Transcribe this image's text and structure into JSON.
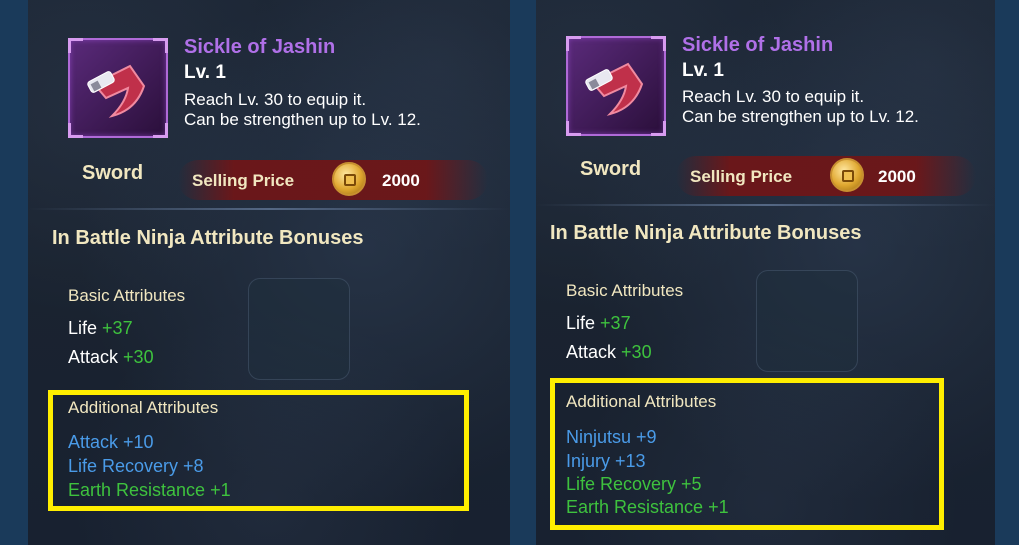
{
  "panels": [
    {
      "item": {
        "name": "Sickle of Jashin",
        "level": "Lv. 1",
        "desc_line1": "Reach Lv. 30 to equip it.",
        "desc_line2": "Can be strengthen up to Lv. 12.",
        "type": "Sword",
        "selling_label": "Selling Price",
        "selling_price": "2000"
      },
      "section_title": "In Battle Ninja Attribute Bonuses",
      "basic": {
        "heading": "Basic Attributes",
        "rows": [
          {
            "name": "Life",
            "value": "+37"
          },
          {
            "name": "Attack",
            "value": "+30"
          }
        ]
      },
      "additional": {
        "heading": "Additional Attributes",
        "rows": [
          {
            "text": "Attack +10",
            "color": "#4a9be8"
          },
          {
            "text": "Life Recovery +8",
            "color": "#4a9be8"
          },
          {
            "text": "Earth Resistance +1",
            "color": "#3ec23e"
          }
        ]
      }
    },
    {
      "item": {
        "name": "Sickle of Jashin",
        "level": "Lv. 1",
        "desc_line1": "Reach Lv. 30 to equip it.",
        "desc_line2": "Can be strengthen up to Lv. 12.",
        "type": "Sword",
        "selling_label": "Selling Price",
        "selling_price": "2000"
      },
      "section_title": "In Battle Ninja Attribute Bonuses",
      "basic": {
        "heading": "Basic Attributes",
        "rows": [
          {
            "name": "Life",
            "value": "+37"
          },
          {
            "name": "Attack",
            "value": "+30"
          }
        ]
      },
      "additional": {
        "heading": "Additional Attributes",
        "rows": [
          {
            "text": "Ninjutsu +9",
            "color": "#4a9be8"
          },
          {
            "text": "Injury +13",
            "color": "#4a9be8"
          },
          {
            "text": "Life Recovery +5",
            "color": "#3ec23e"
          },
          {
            "text": "Earth Resistance +1",
            "color": "#3ec23e"
          }
        ]
      }
    }
  ],
  "colors": {
    "highlight": "#ffee00",
    "item_name": "#b070e8",
    "basic_bonus": "#3ec23e",
    "heading": "#f1e7c0"
  },
  "icons": [
    "sickle-weapon-icon",
    "coin-icon"
  ]
}
